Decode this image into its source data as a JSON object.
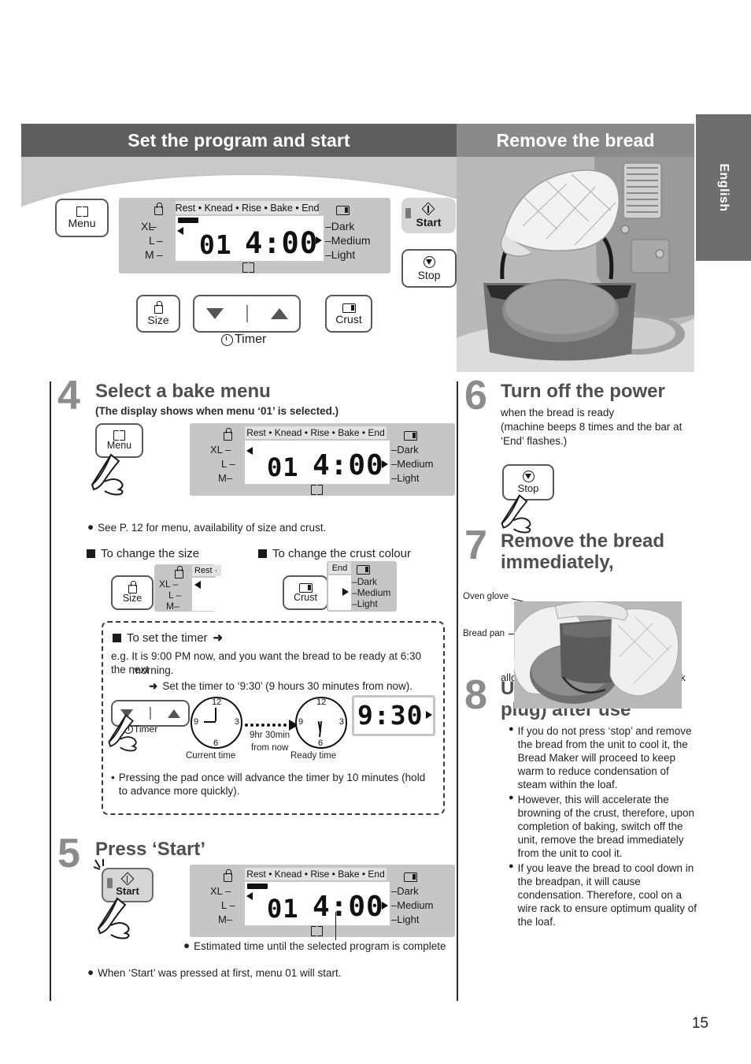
{
  "page": {
    "number": "15",
    "language_tab": "English"
  },
  "banners": {
    "left": "Set the program and start",
    "right": "Remove the bread"
  },
  "panel": {
    "menu_button": "Menu",
    "size_button": "Size",
    "crust_button": "Crust",
    "start_button": "Start",
    "stop_button": "Stop",
    "timer_label": "Timer",
    "icons": {
      "menu": "book-icon",
      "size": "loaf-size-icon",
      "crust": "bread-slice-icon",
      "start": "diamond-power-icon",
      "stop": "stop-circle-icon",
      "timer": "clock-icon"
    }
  },
  "lcd": {
    "phase_bar": "Rest • Knead • Rise • Bake • End",
    "phases": [
      "Rest",
      "Knead",
      "Rise",
      "Bake",
      "End"
    ],
    "menu_number": "01",
    "time": "4:00",
    "sizes": [
      "XL",
      "L",
      "M"
    ],
    "crusts": [
      "Dark",
      "Medium",
      "Light"
    ],
    "selected_size": "XL",
    "selected_crust": "Medium"
  },
  "steps": [
    {
      "number": "4",
      "title": "Select a bake menu",
      "subtitle": "(The display shows when menu ‘01’ is selected.)",
      "button": "Menu",
      "note": "See P. 12 for menu, availability of size and crust.",
      "sections": [
        {
          "heading": "To change the size",
          "button": "Size"
        },
        {
          "heading": "To change the crust colour",
          "button": "Crust"
        }
      ]
    },
    {
      "number": "5",
      "title": "Press ‘Start’",
      "button": "Start",
      "caption": "Estimated time until the selected program is complete",
      "note": "When ‘Start’ was pressed at first, menu 01 will start."
    },
    {
      "number": "6",
      "title": "Turn off the power",
      "body_lines": [
        "when the bread is ready",
        "(machine beeps 8 times and the bar at",
        "‘End’ flashes.)"
      ],
      "button": "Stop"
    },
    {
      "number": "7",
      "title_lines": [
        "Remove the bread",
        "immediately,"
      ],
      "photo_labels": [
        "Oven glove",
        "Bread pan"
      ],
      "caption": "allow to cool, for example, on a wire rack"
    },
    {
      "number": "8",
      "title_lines": [
        "Unplug (holding the",
        "plug) after use"
      ],
      "bullets": [
        "If you do not press ‘stop’ and remove the bread from the unit to cool it, the Bread Maker will proceed to keep warm to reduce condensation of steam within the loaf.",
        "However, this will accelerate the browning of the crust, therefore, upon completion of baking, switch off the unit, remove the bread immediately from the unit to cool it.",
        "If you leave the bread to cool down in the breadpan, it will cause condensation. Therefore, cool on a wire rack to ensure optimum quality of the loaf."
      ]
    }
  ],
  "timer_box": {
    "heading": "To set the timer",
    "arrow": "➜",
    "example_lines": [
      "e.g. It is 9:00 PM now, and you want the bread to be ready at 6:30 the next",
      "morning."
    ],
    "example_indent": "morning.",
    "set_line": "Set the timer to ‘9:30’ (9 hours 30 minutes from now).",
    "timer_pad_label": "Timer",
    "clock_numbers": [
      "12",
      "3",
      "6",
      "9"
    ],
    "current_time_label": "Current time",
    "ready_time_label": "Ready time",
    "elapsed_lines": [
      "9hr 30min",
      "from now"
    ],
    "display_value": "9:30",
    "footnote": "Pressing the pad once will advance the timer by 10 minutes (hold to advance more quickly)."
  },
  "colors": {
    "banner_left_bg": "#5e5e5e",
    "banner_right_bg": "#8a8a8a",
    "hero_bg": "#c9c9c9",
    "lcd_panel_bg": "#c6c6c6",
    "step_number": "#8c8c8c",
    "step_title": "#4f4f4f",
    "body_text": "#231f20",
    "tab_bg": "#6e6e6e"
  }
}
